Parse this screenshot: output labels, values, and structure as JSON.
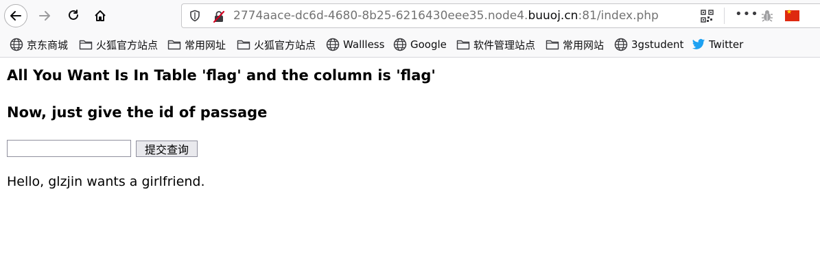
{
  "browser": {
    "url_prefix": "2774aace-dc6d-4680-8b25-6216430eee35.node4.",
    "url_host": "buuoj.cn",
    "url_suffix": ":81/index.php",
    "more_label": "•••",
    "flag_star": "★"
  },
  "bookmarks": [
    {
      "label": "京东商城",
      "icon": "globe-icon"
    },
    {
      "label": "火狐官方站点",
      "icon": "folder-icon"
    },
    {
      "label": "常用网址",
      "icon": "folder-icon"
    },
    {
      "label": "火狐官方站点",
      "icon": "folder-icon"
    },
    {
      "label": "Wallless",
      "icon": "globe-icon"
    },
    {
      "label": "Google",
      "icon": "globe-icon"
    },
    {
      "label": "软件管理站点",
      "icon": "folder-icon"
    },
    {
      "label": "常用网站",
      "icon": "folder-icon"
    },
    {
      "label": "3gstudent",
      "icon": "globe-icon"
    },
    {
      "label": "Twitter",
      "icon": "twitter-icon"
    }
  ],
  "page": {
    "heading1": "All You Want Is In Table 'flag' and the column is 'flag'",
    "heading2": "Now, just give the id of passage",
    "input_value": "",
    "submit_label": "提交查询",
    "message": "Hello, glzjin wants a girlfriend."
  },
  "colors": {
    "toolbar_bg": "#f9f9fa",
    "twitter_blue": "#1da1f2",
    "insecure_red": "#d70022",
    "flag_red": "#de2910"
  }
}
